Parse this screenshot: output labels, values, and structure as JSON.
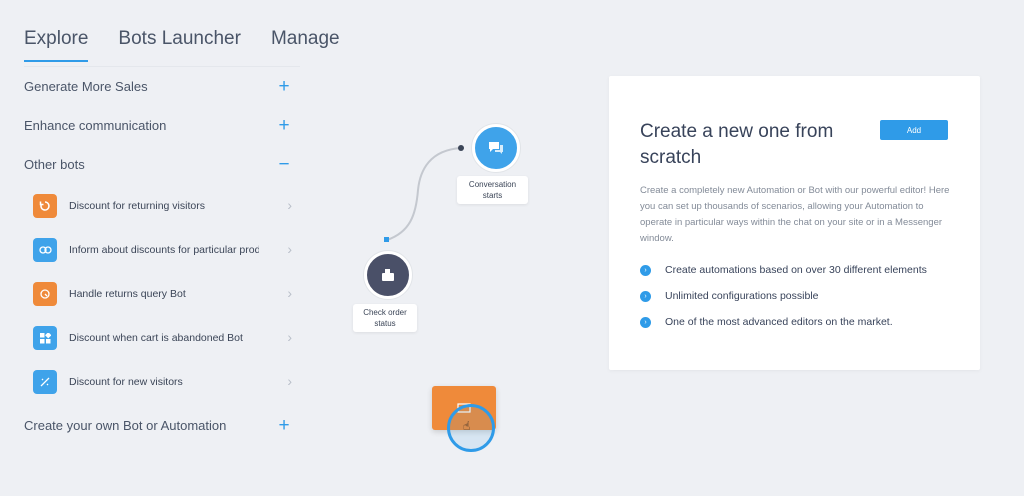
{
  "tabs": [
    {
      "label": "Explore"
    },
    {
      "label": "Bots Launcher"
    },
    {
      "label": "Manage"
    }
  ],
  "sidebar": {
    "sections": [
      {
        "label": "Generate More Sales",
        "toggle": "+"
      },
      {
        "label": "Enhance communication",
        "toggle": "+"
      },
      {
        "label": "Other bots",
        "toggle": "−"
      },
      {
        "label": "Create your own Bot or Automation",
        "toggle": "+"
      }
    ],
    "bots": [
      {
        "label": "Discount for returning visitors",
        "icon": "refresh-icon",
        "color": "#ef8a3a"
      },
      {
        "label": "Inform about discounts for particular produ",
        "icon": "link-icon",
        "color": "#3fa3ea"
      },
      {
        "label": "Handle returns query Bot",
        "icon": "return-icon",
        "color": "#ef8a3a"
      },
      {
        "label": "Discount when cart is abandoned Bot",
        "icon": "grid-icon",
        "color": "#3fa3ea"
      },
      {
        "label": "Discount for new visitors",
        "icon": "tag-icon",
        "color": "#3fa3ea"
      }
    ]
  },
  "flow": {
    "node1": {
      "label_line1": "Conversation",
      "label_line2": "starts",
      "icon": "chat-icon",
      "color": "#3fa3ea"
    },
    "node2": {
      "label_line1": "Check order",
      "label_line2": "status",
      "icon": "bag-icon",
      "color": "#4a5068"
    },
    "node3": {
      "icon": "box-icon",
      "color": "#ef8a3a"
    }
  },
  "card": {
    "title": "Create a new one from scratch",
    "add_label": "Add",
    "description": "Create a completely new Automation or Bot with our powerful editor! Here you can set up thousands of scenarios, allowing your Automation to operate in particular ways within the chat on your site or in a Messenger window.",
    "features": [
      "Create automations based on over 30 different elements",
      "Unlimited configurations possible",
      "One of the most advanced editors on the market."
    ]
  },
  "colors": {
    "accent": "#2f9be8",
    "orange": "#ef8a3a",
    "background": "#eef0f4"
  }
}
